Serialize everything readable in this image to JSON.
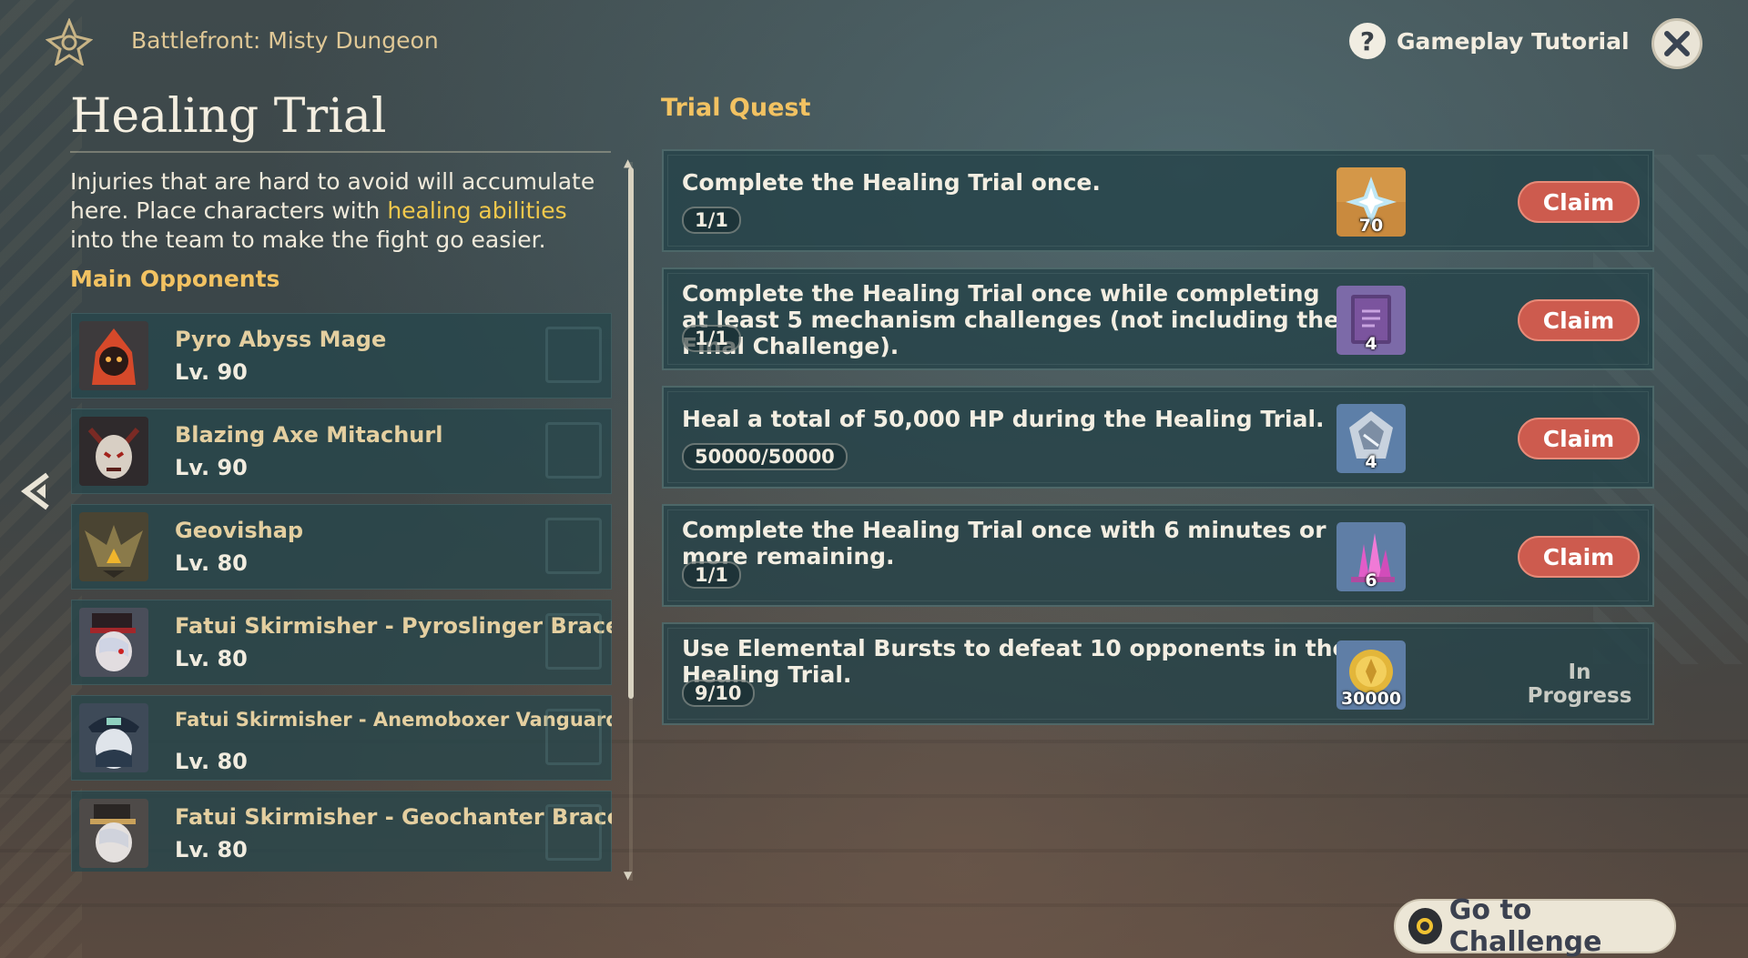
{
  "header": {
    "event_title": "Battlefront: Misty Dungeon",
    "tutorial_label": "Gameplay Tutorial",
    "icons": [
      "event-emblem-icon",
      "question-icon",
      "close-icon"
    ]
  },
  "trial": {
    "title": "Healing Trial",
    "desc_part1": "Injuries that are hard to avoid will accumulate here. Place characters with ",
    "desc_highlight": "healing abilities",
    "desc_part2": " into the team to make the fight go easier."
  },
  "opponents": {
    "heading": "Main Opponents",
    "items": [
      {
        "name": "Pyro Abyss Mage",
        "level": "Lv. 90"
      },
      {
        "name": "Blazing Axe Mitachurl",
        "level": "Lv. 90"
      },
      {
        "name": "Geovishap",
        "level": "Lv. 80"
      },
      {
        "name": "Fatui Skirmisher - Pyroslinger Bracer",
        "level": "Lv. 80"
      },
      {
        "name": "Fatui Skirmisher - Anemoboxer Vanguard",
        "level": "Lv. 80"
      },
      {
        "name": "Fatui Skirmisher - Geochanter Bracer",
        "level": "Lv. 80"
      }
    ]
  },
  "quests": {
    "heading": "Trial Quest",
    "items": [
      {
        "text": "Complete the Healing Trial once.",
        "progress": "1/1",
        "reward_icon": "primogem-icon",
        "reward_count": "70",
        "action": "Claim"
      },
      {
        "text": "Complete the Healing Trial once while completing at least 5 mechanism challenges (not including the Final Challenge).",
        "progress": "1/1",
        "reward_icon": "heros-wit-book-icon",
        "reward_count": "4",
        "action": "Claim"
      },
      {
        "text": "Heal a total of 50,000 HP during the Healing Trial.",
        "progress": "50000/50000",
        "reward_icon": "mystic-enhancement-ore-icon",
        "reward_count": "4",
        "action": "Claim"
      },
      {
        "text": "Complete the Healing Trial once with 6 minutes or more remaining.",
        "progress": "1/1",
        "reward_icon": "crystal-chunk-icon",
        "reward_count": "6",
        "action": "Claim"
      },
      {
        "text": "Use Elemental Bursts to defeat 10 opponents in the Healing Trial.",
        "progress": "9/10",
        "reward_icon": "mora-icon",
        "reward_count": "30000",
        "status": "In Progress"
      }
    ]
  },
  "footer": {
    "go_label": "Go to Challenge"
  },
  "colors": {
    "accent_gold": "#f2c262",
    "claim_red": "#cd5b4e",
    "highlight_yellow": "#f2c94c"
  }
}
